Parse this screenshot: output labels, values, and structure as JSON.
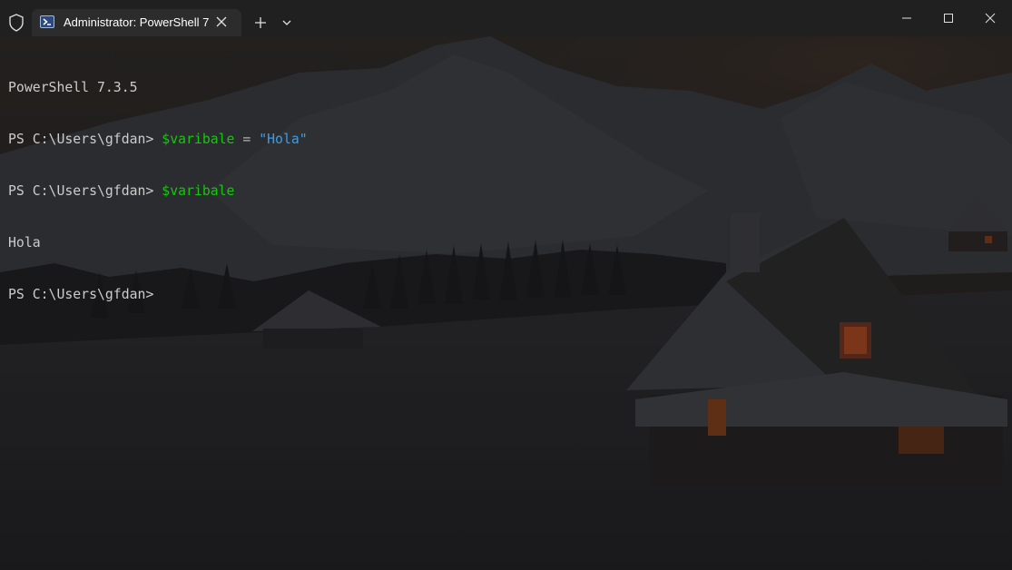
{
  "window": {
    "tab_title": "Administrator: PowerShell 7",
    "controls": [
      "minimize",
      "maximize",
      "close"
    ]
  },
  "terminal": {
    "banner": "PowerShell 7.3.5",
    "prompt": "PS C:\\Users\\gfdan>",
    "cmd1": {
      "variable": "$varibale",
      "operator": "=",
      "string": "\"Hola\""
    },
    "cmd2": {
      "variable": "$varibale"
    },
    "output": "Hola"
  },
  "colors": {
    "variable": "#16c60c",
    "string": "#3b9eea",
    "text": "#cccccc",
    "titlebar": "#202020",
    "tab": "#2c2c2c"
  },
  "icons": {
    "shield": "shield-icon",
    "tab": "powershell-icon",
    "tab_close": "close-icon",
    "new_tab": "plus-icon",
    "dropdown": "chevron-down-icon"
  }
}
